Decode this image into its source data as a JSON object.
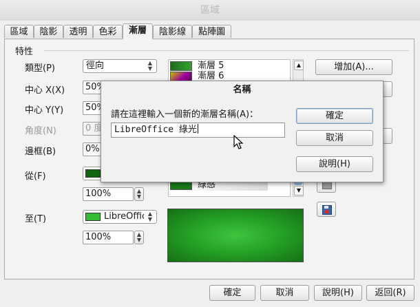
{
  "window": {
    "title": "區域"
  },
  "tabs": [
    {
      "label": "區域"
    },
    {
      "label": "陰影"
    },
    {
      "label": "透明"
    },
    {
      "label": "色彩"
    },
    {
      "label": "漸層",
      "active": true
    },
    {
      "label": "陰影線"
    },
    {
      "label": "點陣圖"
    }
  ],
  "properties": {
    "section_title": "特性",
    "type_label": "類型(P)",
    "type_value": "徑向",
    "center_x_label": "中心 X(X)",
    "center_x_value": "50%",
    "center_y_label": "中心 Y(Y)",
    "center_y_value": "50%",
    "angle_label": "角度(N)",
    "angle_value": "0 度",
    "border_label": "邊框(B)",
    "border_value": "0%",
    "from_label": "從(F)",
    "from_color": "#116611",
    "from_intensity": "100%",
    "to_label": "至(T)",
    "to_color": "#33bb33",
    "to_color_name": "LibreOffice 綠光",
    "to_intensity": "100%"
  },
  "gradient_list": {
    "items": [
      {
        "label": "漸層 5"
      },
      {
        "label": "漸層 6"
      },
      {
        "label": "綠感"
      }
    ]
  },
  "right_buttons": {
    "add_label": "增加(A)..."
  },
  "bottom_buttons": {
    "ok_label": "確定",
    "cancel_label": "取消",
    "help_label": "說明(H)",
    "reset_label": "返回(R)"
  },
  "name_dialog": {
    "title": "名稱",
    "prompt": "請在這裡輸入一個新的漸層名稱(A)：",
    "input_value": "LibreOffice 綠光",
    "ok_label": "確定",
    "cancel_label": "取消",
    "help_label": "說明(H)"
  },
  "colors": {
    "accent_border": "#7a98b8",
    "preview_center": "#3fc43f",
    "preview_edge": "#166f16"
  }
}
